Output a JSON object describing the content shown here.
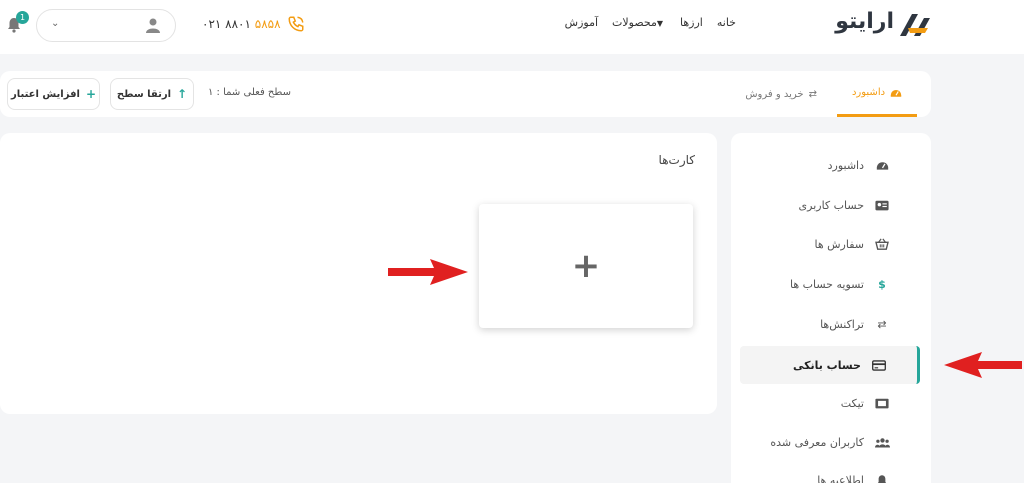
{
  "header": {
    "logo_text": "ارایتو",
    "nav": [
      "خانه",
      "ارزها",
      "محصولات",
      "آموزش"
    ],
    "phone_prefix": "۰۲۱ ۸۸۰۱",
    "phone_suffix": "۵۸۵۸",
    "notification_count": "1"
  },
  "tabs": {
    "dashboard": "داشبورد",
    "trade": "خرید و فروش",
    "level_text": "سطح فعلی شما : ۱",
    "upgrade_button": "ارتقا سطح",
    "credit_button": "افزایش اعتبار"
  },
  "cards": {
    "title": "کارت‌ها"
  },
  "sidebar": {
    "items": [
      {
        "label": "داشبورد",
        "icon": "gauge-icon"
      },
      {
        "label": "حساب کاربری",
        "icon": "id-card-icon"
      },
      {
        "label": "سفارش ها",
        "icon": "basket-icon"
      },
      {
        "label": "تسویه حساب ها",
        "icon": "dollar-icon"
      },
      {
        "label": "تراکنش‌ها",
        "icon": "exchange-icon"
      },
      {
        "label": "حساب بانکی",
        "icon": "credit-card-icon"
      },
      {
        "label": "تیکت",
        "icon": "ticket-icon"
      },
      {
        "label": "کاربران معرفی شده",
        "icon": "users-icon"
      },
      {
        "label": "اطلاعیه ها",
        "icon": "bell-icon"
      }
    ],
    "active_index": 5
  },
  "colors": {
    "accent": "#f39c12",
    "teal": "#26a69a",
    "annotation_red": "#e02020"
  }
}
